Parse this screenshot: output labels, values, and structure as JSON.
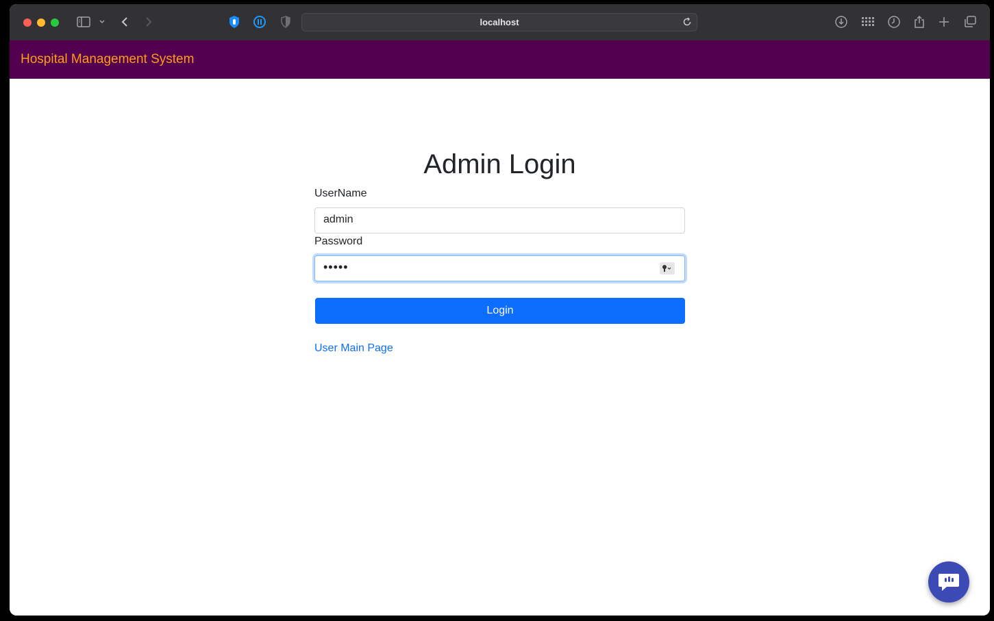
{
  "browser": {
    "url": "localhost"
  },
  "navbar": {
    "brand": "Hospital Management System"
  },
  "form": {
    "title": "Admin Login",
    "username_label": "UserName",
    "username_value": "admin",
    "password_label": "Password",
    "password_value": "•••••",
    "login_label": "Login",
    "user_link": "User Main Page"
  },
  "colors": {
    "navbar_bg": "#52004f",
    "brand": "#ff9c19",
    "primary": "#0d6efd",
    "chat_bg": "#3c4ab5"
  },
  "icons": [
    "sidebar-icon",
    "chevron-down-icon",
    "back-icon",
    "forward-icon",
    "hand-icon",
    "pause-icon",
    "shield-icon",
    "reload-icon",
    "download-icon",
    "grid-icon",
    "history-icon",
    "share-icon",
    "plus-icon",
    "tabs-icon",
    "key-icon",
    "chat-icon"
  ]
}
